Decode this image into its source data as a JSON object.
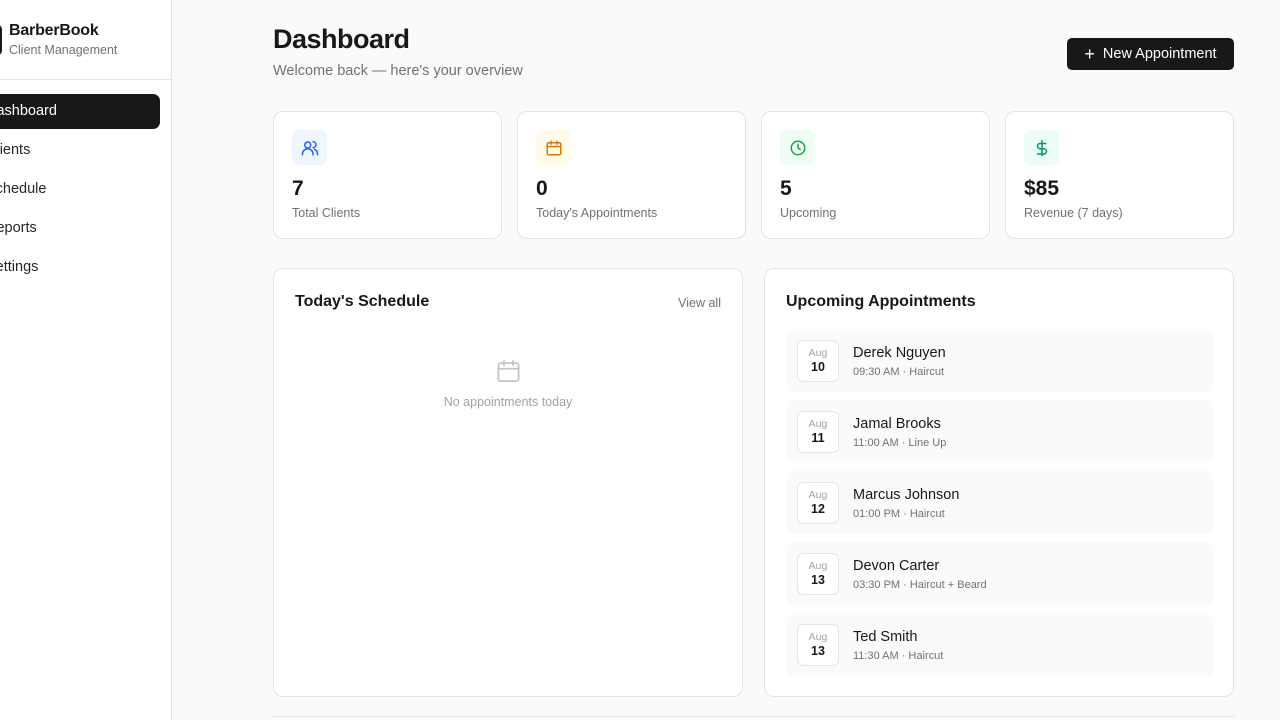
{
  "brand": {
    "name": "BarberBook",
    "subtitle": "Client Management"
  },
  "nav": [
    {
      "label": "Dashboard",
      "active": true
    },
    {
      "label": "Clients"
    },
    {
      "label": "Schedule"
    },
    {
      "label": "Reports"
    },
    {
      "label": "Settings"
    }
  ],
  "header": {
    "title": "Dashboard",
    "subtitle": "Welcome back — here's your overview",
    "new_button": "New Appointment"
  },
  "stats": [
    {
      "value": "7",
      "label": "Total Clients",
      "icon": "users-icon",
      "color": "#2563eb",
      "bg": "#eff6ff"
    },
    {
      "value": "0",
      "label": "Today's Appointments",
      "icon": "calendar-icon",
      "color": "#d97706",
      "bg": "#fffbeb"
    },
    {
      "value": "5",
      "label": "Upcoming",
      "icon": "clock-icon",
      "color": "#16a34a",
      "bg": "#f0fdf4"
    },
    {
      "value": "$85",
      "label": "Revenue (7 days)",
      "icon": "dollar-icon",
      "color": "#059669",
      "bg": "#ecfdf5"
    }
  ],
  "schedule": {
    "title": "Today's Schedule",
    "view_all": "View all",
    "empty_text": "No appointments today"
  },
  "upcoming": {
    "title": "Upcoming Appointments",
    "items": [
      {
        "month": "Aug",
        "day": "10",
        "name": "Derek Nguyen",
        "meta": "09:30 AM · Haircut"
      },
      {
        "month": "Aug",
        "day": "11",
        "name": "Jamal Brooks",
        "meta": "11:00 AM · Line Up"
      },
      {
        "month": "Aug",
        "day": "12",
        "name": "Marcus Johnson",
        "meta": "01:00 PM · Haircut"
      },
      {
        "month": "Aug",
        "day": "13",
        "name": "Devon Carter",
        "meta": "03:30 PM · Haircut + Beard"
      },
      {
        "month": "Aug",
        "day": "13",
        "name": "Ted Smith",
        "meta": "11:30 AM · Haircut"
      }
    ]
  }
}
